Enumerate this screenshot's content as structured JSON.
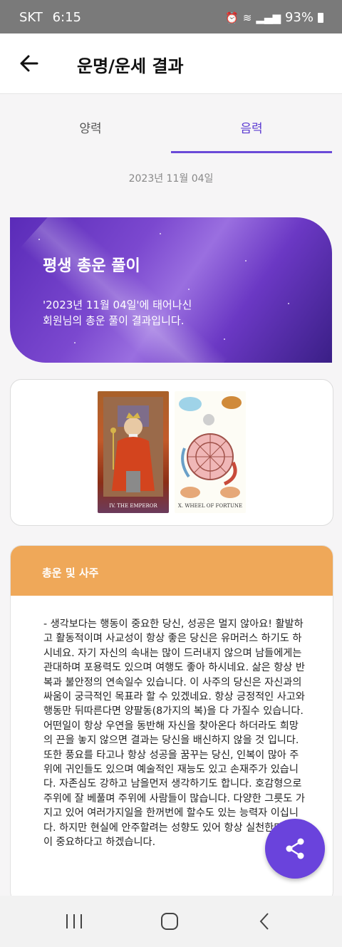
{
  "status_bar": {
    "carrier": "SKT",
    "time": "6:15",
    "battery": "93%"
  },
  "header": {
    "title": "운명/운세 결과"
  },
  "tabs": [
    {
      "label": "양력",
      "selected": false
    },
    {
      "label": "음력",
      "selected": true
    }
  ],
  "date_text": "2023년 11월 04일",
  "banner": {
    "title": "평생 총운 풀이",
    "line1": "'2023년 11월 04일'에 태어나신",
    "line2": "회원님의 총운 풀이 결과입니다."
  },
  "cards": [
    {
      "label": "IV. THE EMPEROR",
      "icon": "emperor-card"
    },
    {
      "label": "X. WHEEL OF FORTUNE",
      "icon": "wheel-of-fortune-card"
    }
  ],
  "fortune": {
    "title": "총운 및 사주",
    "text": "- 생각보다는 행동이 중요한 당신, 성공은 멀지 않아요! 활발하고 활동적이며 사교성이 항상 좋은 당신은 유머러스 하기도 하시네요. 자기 자신의 속내는 많이 드러내지 않으며 남들에게는 관대하며 포용력도 있으며 여행도 좋아 하시네요. 삶은 항상 반복과 불안정의 연속일수 있습니다. 이 사주의 당신은 자신과의 싸움이 궁극적인 목표라 할 수 있겠네요. 항상 긍정적인 사고와 행동만 뒤따른다면 양팔동(8가지의 복)을 다 가질수 있습니다. 어떤일이 항상 우연을 동반해 자신을 찾아온다 하더라도 희망의 끈을 놓지 않으면 결과는 당신을 배신하지 않을 것 입니다. 또한 풍요를 타고나 항상 성공을 꿈꾸는 당신, 인복이 많아 주위에 귀인들도 있으며 예술적인 재능도 있고 손재주가 있습니다. 자존심도 강하고 남을먼저 생각하기도 합니다. 호감형으로 주위에 잘 베풀며 주위에 사람들이 많습니다. 다양한 그릇도 가지고 있어 여러가지일을 한꺼번에 할수도 있는 능력자 이십니다. 하지만 현실에 안주할려는 성향도 있어 항상 실천한다는 맘이 중요하다고 하겠습니다."
  },
  "colors": {
    "accent": "#6a43dc",
    "orange": "#efa859"
  }
}
